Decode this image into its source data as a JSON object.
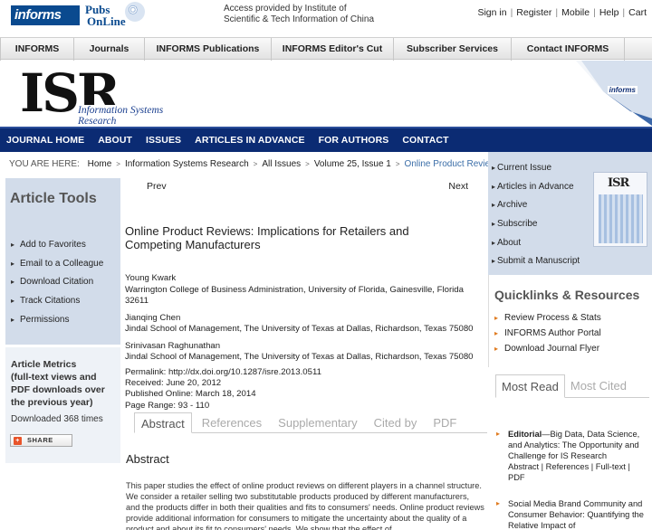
{
  "header": {
    "logo_informs": "informs",
    "logo_pubs_line1": "Pubs",
    "logo_pubs_line2": "OnLine",
    "access_line1": "Access provided by Institute of",
    "access_line2": "Scientific & Tech Information of China",
    "links": [
      "Sign in",
      "Register",
      "Mobile",
      "Help",
      "Cart"
    ]
  },
  "graynav": [
    "INFORMS",
    "Journals",
    "INFORMS Publications",
    "INFORMS Editor's Cut",
    "Subscriber Services",
    "Contact INFORMS"
  ],
  "banner": {
    "logo_letters": "ISR",
    "logo_subtitle": "Information Systems Research",
    "corner_badge": "informs"
  },
  "bluenav": [
    "JOURNAL HOME",
    "ABOUT",
    "ISSUES",
    "ARTICLES IN ADVANCE",
    "FOR AUTHORS",
    "CONTACT"
  ],
  "breadcrumb": {
    "prefix": "YOU ARE HERE:",
    "items": [
      "Home",
      "Information Systems Research",
      "All Issues",
      "Volume 25, Issue 1"
    ],
    "current": "Online Product Reviews: ..."
  },
  "article_tools": {
    "title": "Article Tools",
    "items": [
      "Add to Favorites",
      "Email to a Colleague",
      "Download Citation",
      "Track Citations",
      "Permissions"
    ]
  },
  "metrics": {
    "title": "Article Metrics",
    "desc": "(full-text views and PDF downloads over the previous year)",
    "downloads": "Downloaded 368 times",
    "share_label": "SHARE"
  },
  "pager": {
    "prev": "Prev",
    "next": "Next"
  },
  "article": {
    "title": "Online Product Reviews: Implications for Retailers and Competing Manufacturers",
    "authors": [
      {
        "name": "Young Kwark",
        "affiliation": "Warrington College of Business Administration, University of Florida, Gainesville, Florida 32611"
      },
      {
        "name": "Jianqing Chen",
        "affiliation": "Jindal School of Management, The University of Texas at Dallas, Richardson, Texas 75080"
      },
      {
        "name": "Srinivasan Raghunathan",
        "affiliation": "Jindal School of Management, The University of Texas at Dallas, Richardson, Texas 75080"
      }
    ],
    "permalink_label": "Permalink:",
    "permalink": "http://dx.doi.org/10.1287/isre.2013.0511",
    "received": "Received: June 20, 2012",
    "published": "Published Online: March 18, 2014",
    "pages": "Page Range: 93 - 110",
    "tabs": [
      "Abstract",
      "References",
      "Supplementary",
      "Cited by",
      "PDF"
    ],
    "abstract_heading": "Abstract",
    "abstract_text": "This paper studies the effect of online product reviews on different players in a channel structure. We consider a retailer selling two substitutable products produced by different manufacturers, and the products differ in both their qualities and fits to consumers' needs. Online product reviews provide additional information for consumers to mitigate the uncertainty about the quality of a product and about its fit to consumers' needs. We show that the effect of"
  },
  "right_sidebar": {
    "links": [
      "Current Issue",
      "Articles in Advance",
      "Archive",
      "Subscribe",
      "About",
      "Submit a Manuscript"
    ],
    "cover_letters": "ISR",
    "quicklinks_title": "Quicklinks & Resources",
    "quicklinks": [
      "Review Process & Stats",
      "INFORMS Author Portal",
      "Download Journal Flyer"
    ],
    "most_tabs": [
      "Most Read",
      "Most Cited"
    ],
    "most_read": [
      {
        "bold": "Editorial",
        "text": "—Big Data, Data Science, and Analytics: The Opportunity and Challenge for IS Research",
        "links": "Abstract | References | Full-text | PDF"
      },
      {
        "bold": "",
        "text": "Social Media Brand Community and Consumer Behavior: Quantifying the Relative Impact of",
        "links": ""
      }
    ]
  },
  "colors": {
    "blue_nav": "#0b2b73",
    "tools_bg": "#d2dcea",
    "link_current": "#3b6ea8",
    "accent_orange": "#e07a1f"
  }
}
